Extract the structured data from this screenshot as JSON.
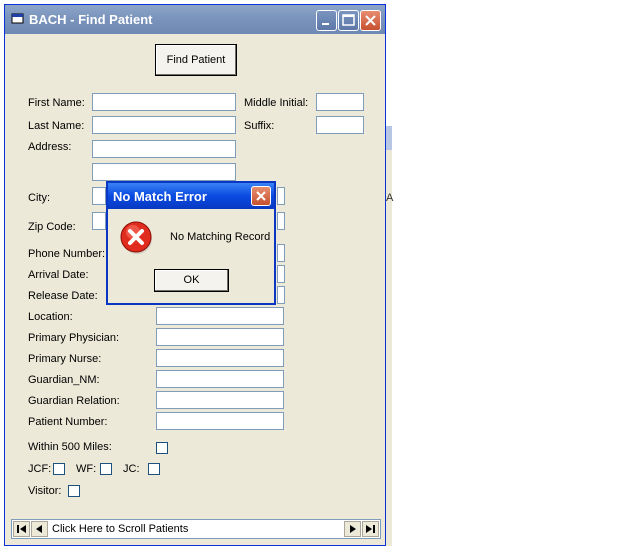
{
  "window": {
    "title": "BACH - Find Patient",
    "find_button": "Find Patient"
  },
  "form": {
    "first_name_label": "First Name:",
    "middle_initial_label": "Middle Initial:",
    "last_name_label": "Last Name:",
    "suffix_label": "Suffix:",
    "address_label": "Address:",
    "city_label": "City:",
    "zip_label": "Zip Code:",
    "phone_label": "Phone Number:",
    "arrival_label": "Arrival Date:",
    "release_label": "Release Date:",
    "location_label": "Location:",
    "physician_label": "Primary Physician:",
    "nurse_label": "Primary Nurse:",
    "guardian_label": "Guardian_NM:",
    "guardian_relation_label": "Guardian Relation:",
    "patient_number_label": "Patient Number:",
    "within_label": "Within 500 Miles:",
    "jcf_label": "JCF:",
    "wf_label": "WF:",
    "jc_label": "JC:",
    "visitor_label": "Visitor:"
  },
  "navigator": {
    "caption": "Click Here to Scroll Patients"
  },
  "dialog": {
    "title": "No Match Error",
    "message": "No Matching Record",
    "ok": "OK"
  },
  "icons": [
    "app-icon",
    "minimize-icon",
    "maximize-icon",
    "close-icon",
    "error-icon",
    "first-record-icon",
    "prev-record-icon",
    "next-record-icon",
    "last-record-icon"
  ]
}
